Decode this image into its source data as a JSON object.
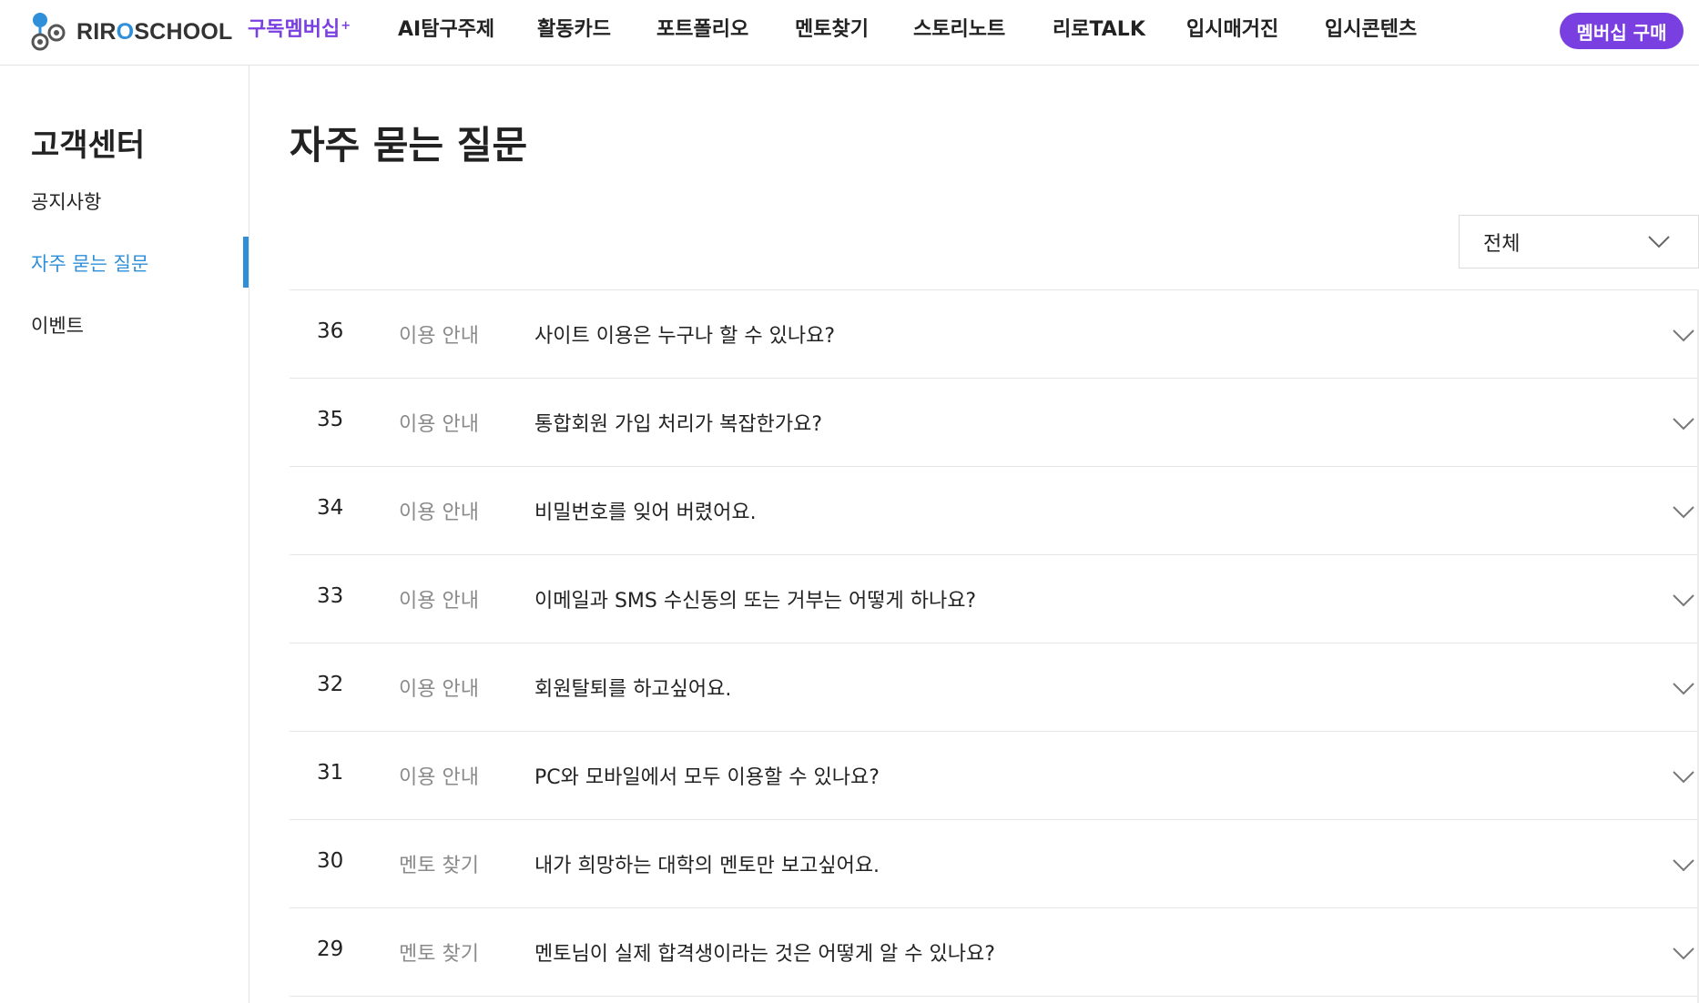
{
  "brand": {
    "logo_text_a": "RIR",
    "logo_text_o": "O",
    "logo_text_b": "SCHOOL"
  },
  "nav": {
    "membership": {
      "label": "구독멤버십",
      "sup": "+"
    },
    "items": [
      "AI탐구주제",
      "활동카드",
      "포트폴리오",
      "멘토찾기",
      "스토리노트",
      "리로TALK",
      "입시매거진",
      "입시콘텐츠"
    ],
    "buy_label": "멤버십 구매"
  },
  "sidebar": {
    "title": "고객센터",
    "items": [
      {
        "label": "공지사항",
        "active": false
      },
      {
        "label": "자주 묻는 질문",
        "active": true
      },
      {
        "label": "이벤트",
        "active": false
      }
    ]
  },
  "main": {
    "title": "자주 묻는 질문",
    "filter": {
      "selected": "전체",
      "icon": "chevron-down-icon"
    },
    "faqs": [
      {
        "num": "36",
        "category": "이용 안내",
        "question": "사이트 이용은 누구나 할 수 있나요?"
      },
      {
        "num": "35",
        "category": "이용 안내",
        "question": "통합회원 가입 처리가 복잡한가요?"
      },
      {
        "num": "34",
        "category": "이용 안내",
        "question": "비밀번호를 잊어 버렸어요."
      },
      {
        "num": "33",
        "category": "이용 안내",
        "question": "이메일과 SMS 수신동의 또는 거부는 어떻게 하나요?"
      },
      {
        "num": "32",
        "category": "이용 안내",
        "question": "회원탈퇴를 하고싶어요."
      },
      {
        "num": "31",
        "category": "이용 안내",
        "question": "PC와 모바일에서 모두 이용할 수 있나요?"
      },
      {
        "num": "30",
        "category": "멘토 찾기",
        "question": "내가 희망하는 대학의 멘토만 보고싶어요."
      },
      {
        "num": "29",
        "category": "멘토 찾기",
        "question": "멘토님이 실제 합격생이라는 것은 어떻게 알 수 있나요?"
      }
    ]
  },
  "colors": {
    "accent_purple": "#7a3fe0",
    "accent_blue": "#2f8fd8",
    "muted_text": "#8a8a8a"
  }
}
